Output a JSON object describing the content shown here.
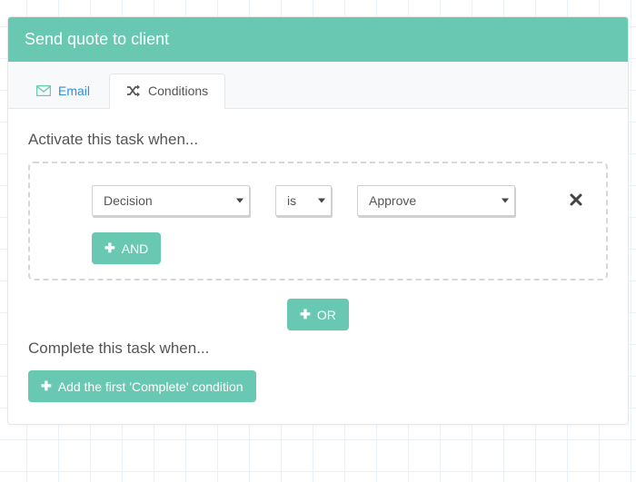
{
  "colors": {
    "accent": "#68c8b1",
    "link": "#2f8fd8",
    "text": "#555555"
  },
  "header": {
    "title": "Send quote to client"
  },
  "tabs": [
    {
      "icon": "envelope-icon",
      "label": "Email",
      "active": false
    },
    {
      "icon": "shuffle-icon",
      "label": "Conditions",
      "active": true
    }
  ],
  "activate": {
    "title": "Activate this task when...",
    "rows": [
      {
        "field": "Decision",
        "operator": "is",
        "value": "Approve"
      }
    ],
    "and_label": "AND",
    "or_label": "OR"
  },
  "complete": {
    "title": "Complete this task when...",
    "add_first_label": "Add the first 'Complete' condition"
  }
}
